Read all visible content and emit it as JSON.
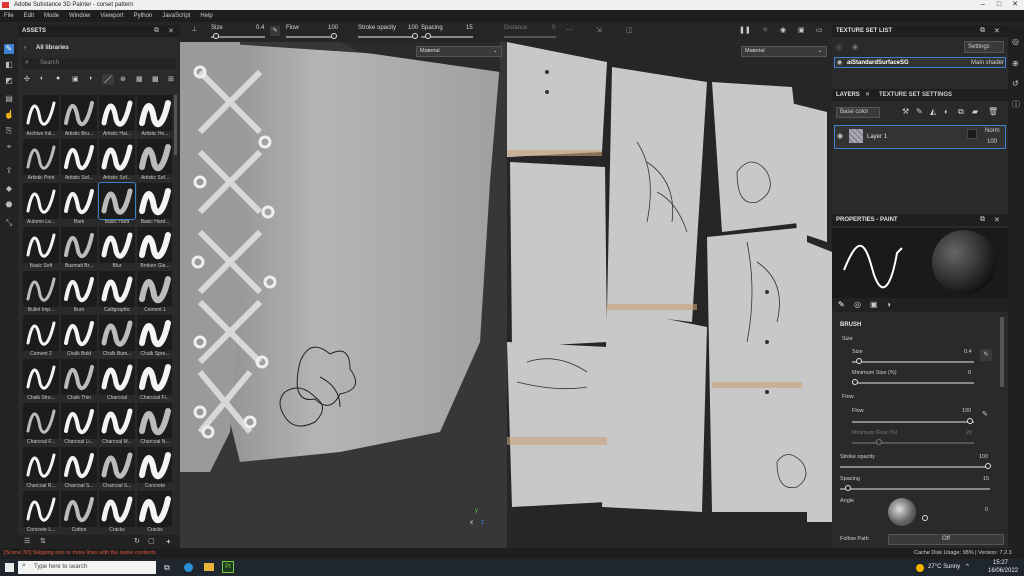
{
  "window": {
    "title": "Adobe Substance 3D Painter - corset pattern"
  },
  "menu": [
    "File",
    "Edit",
    "Mode",
    "Window",
    "Viewport",
    "Python",
    "JavaScript",
    "Help"
  ],
  "toolbar": {
    "size_label": "Size",
    "size_value": "0.4",
    "flow_label": "Flow",
    "flow_value": "100",
    "stroke_label": "Stroke opacity",
    "stroke_value": "100",
    "spacing_label": "Spacing",
    "spacing_value": "15",
    "distance_label": "Distance",
    "distance_value": "0"
  },
  "assets": {
    "title": "ASSETS",
    "library": "All libraries",
    "search_placeholder": "Search",
    "items": [
      "Archive Ink...",
      "Artistic Bru...",
      "Artistic Hai...",
      "Artistic He...",
      "Artistic Print",
      "Artistic Sof...",
      "Artistic Sof...",
      "Artistic Sof...",
      "Autumn Le...",
      "Bark",
      "Basic Hard",
      "Basic Hard...",
      "Basic Soft",
      "Basmati Br...",
      "Blur",
      "Broken Gla...",
      "Bullet Imp...",
      "Burn",
      "Calligraphic",
      "Cement 1",
      "Cement 2",
      "Chalk Bold",
      "Chalk Bum...",
      "Chalk Spre...",
      "Chalk Stro...",
      "Chalk Thin",
      "Charcoal",
      "Charcoal Fi...",
      "Charcoal F...",
      "Charcoal Li...",
      "Charcoal M...",
      "Charcoal N...",
      "Charcoal R...",
      "Charcoal S...",
      "Charcoal S...",
      "Concrete",
      "Concrete L...",
      "Cotton",
      "Cracks",
      "Cracks"
    ]
  },
  "viewport": {
    "left_mode": "Material",
    "right_mode": "Material"
  },
  "texture_set_list": {
    "title": "TEXTURE SET LIST",
    "settings": "Settings",
    "set_name": "aiStandardSurfaceSG",
    "shader": "Main shader"
  },
  "layers": {
    "tab1": "LAYERS",
    "tab2": "TEXTURE SET SETTINGS",
    "channel": "Base color",
    "layer_name": "Layer 1",
    "blend": "Norm",
    "opacity": "100"
  },
  "properties": {
    "title": "PROPERTIES - PAINT",
    "section": "BRUSH",
    "size_group": "Size",
    "size_label": "Size",
    "size_value": "0.4",
    "minsize_label": "Minimum Size (%)",
    "minsize_value": "0",
    "flow_group": "Flow",
    "flow_label": "Flow",
    "flow_value": "100",
    "minflow_label": "Minimum Flow (%)",
    "minflow_value": "20",
    "stroke_label": "Stroke opacity",
    "stroke_value": "100",
    "spacing_label": "Spacing",
    "spacing_value": "15",
    "angle_label": "Angle",
    "angle_value": "0",
    "followpath_label": "Follow Path",
    "followpath_value": "Off"
  },
  "status": {
    "message": "[Scene 3D] Skipping one or more lines with the same contents",
    "cache": "Cache Disk Usage: 98% | Version: 7.2.3"
  },
  "taskbar": {
    "search_placeholder": "Type here to search",
    "weather": "27°C Sunny",
    "time": "15:27",
    "date": "16/06/2022"
  },
  "colors": {
    "accent": "#3d7fd1",
    "error": "#e0533d"
  }
}
